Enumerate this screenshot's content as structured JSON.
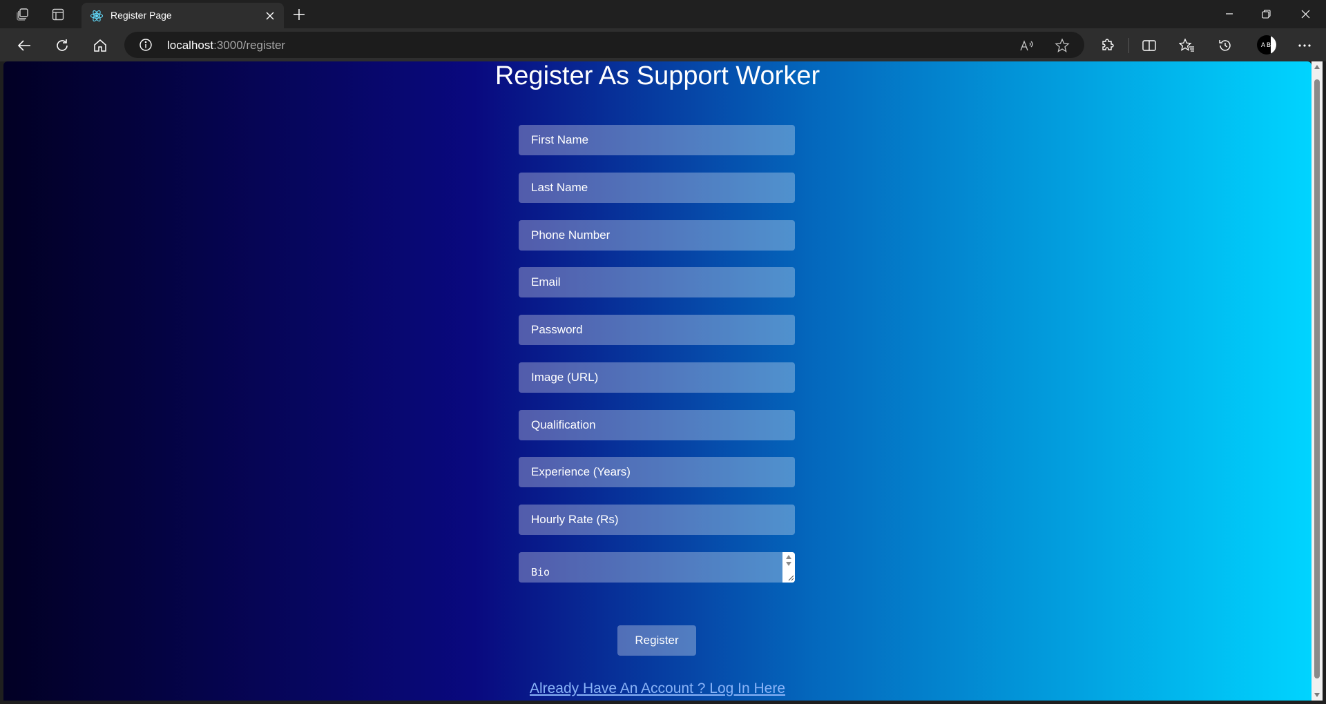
{
  "browser": {
    "tab_title": "Register Page",
    "url_host": "localhost",
    "url_path": ":3000/register",
    "avatar_text": "A Bi"
  },
  "page": {
    "title": "Register As Support Worker",
    "fields": {
      "first_name": "First Name",
      "last_name": "Last Name",
      "phone": "Phone Number",
      "email": "Email",
      "password": "Password",
      "image_url": "Image (URL)",
      "qualification": "Qualification",
      "experience": "Experience (Years)",
      "hourly_rate": "Hourly Rate (Rs)",
      "bio": "Bio"
    },
    "register_label": "Register",
    "login_link": "Already Have An Account ? Log In Here"
  },
  "colors": {
    "gradient_start": "#020024",
    "gradient_mid": "#09097f",
    "gradient_end": "#00d4ff",
    "chrome_bg": "#202020",
    "link": "#8ab4f8"
  },
  "icons": [
    "workspaces-icon",
    "tab-actions-icon",
    "react-favicon-icon",
    "close-icon",
    "plus-icon",
    "minimize-icon",
    "restore-icon",
    "back-arrow-icon",
    "refresh-icon",
    "home-icon",
    "info-icon",
    "read-aloud-icon",
    "favorite-star-icon",
    "extensions-icon",
    "split-screen-icon",
    "favorites-icon",
    "history-icon",
    "more-icon"
  ]
}
